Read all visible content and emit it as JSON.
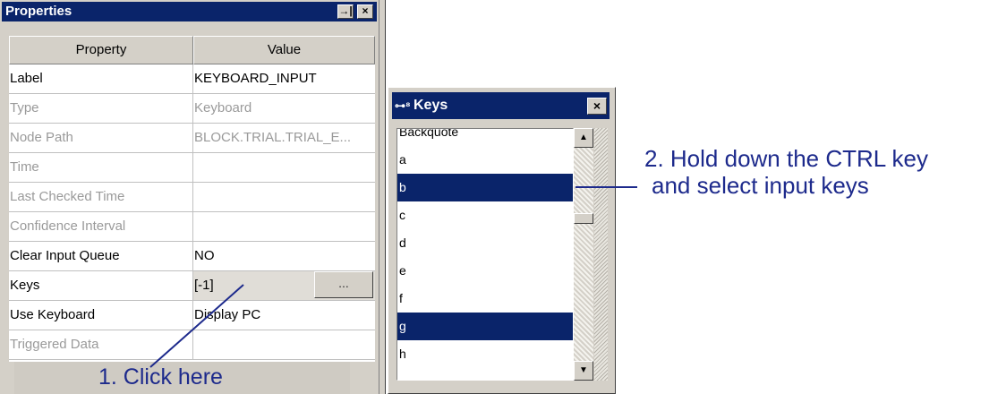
{
  "properties_panel": {
    "title": "Properties",
    "pin_glyph": "→|",
    "close_glyph": "×",
    "headers": {
      "property": "Property",
      "value": "Value"
    },
    "rows": [
      {
        "property": "Label",
        "value": "KEYBOARD_INPUT",
        "enabled": true
      },
      {
        "property": "Type",
        "value": "Keyboard",
        "enabled": false
      },
      {
        "property": "Node Path",
        "value": "BLOCK.TRIAL.TRIAL_E...",
        "enabled": false
      },
      {
        "property": "Time",
        "value": "",
        "enabled": false
      },
      {
        "property": "Last Checked Time",
        "value": "",
        "enabled": false
      },
      {
        "property": "Confidence Interval",
        "value": "",
        "enabled": false
      },
      {
        "property": "Clear Input Queue",
        "value": "NO",
        "enabled": true
      },
      {
        "property": "Keys",
        "value": "[-1]",
        "enabled": true,
        "button": "..."
      },
      {
        "property": "Use Keyboard",
        "value": "Display PC",
        "enabled": true
      },
      {
        "property": "Triggered Data",
        "value": "",
        "enabled": false
      }
    ]
  },
  "keys_window": {
    "title": "Keys",
    "icon": "key-icon",
    "close_glyph": "×",
    "items": [
      {
        "label": "Backquote",
        "selected": false
      },
      {
        "label": "a",
        "selected": false
      },
      {
        "label": "b",
        "selected": true
      },
      {
        "label": "c",
        "selected": false
      },
      {
        "label": "d",
        "selected": false
      },
      {
        "label": "e",
        "selected": false
      },
      {
        "label": "f",
        "selected": false
      },
      {
        "label": "g",
        "selected": true
      },
      {
        "label": "h",
        "selected": false
      }
    ]
  },
  "annotations": {
    "step1": "1. Click here",
    "step2_line1": "2. Hold down the CTRL key",
    "step2_line2": "and select input keys"
  },
  "colors": {
    "title_bar": "#0a246a",
    "selection": "#0a246a",
    "annotation": "#1d2a8c",
    "chrome": "#d4d0c8"
  }
}
